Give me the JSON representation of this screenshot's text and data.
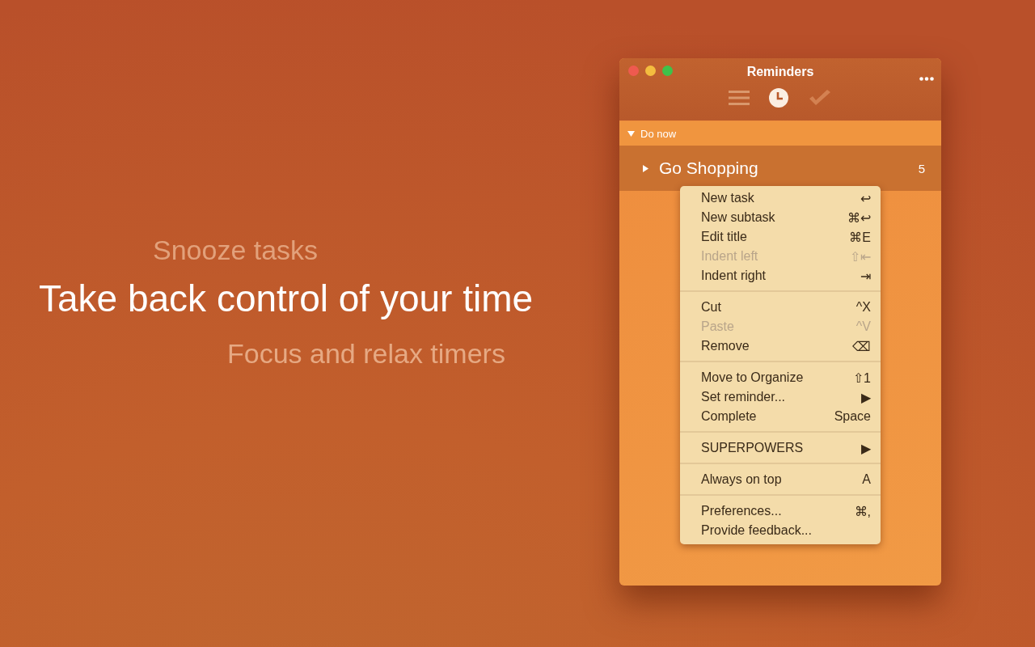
{
  "promo": {
    "subtitle": "Snooze tasks",
    "headline": "Take back control of your time",
    "tagline": "Focus and relax timers"
  },
  "window": {
    "title": "Reminders",
    "toolbar": [
      {
        "kind": "list",
        "selected": false
      },
      {
        "kind": "clock",
        "selected": true
      },
      {
        "kind": "done",
        "selected": false
      }
    ],
    "sections": [
      {
        "label": "Do now",
        "expanded": true,
        "tasks": [
          {
            "title": "Go Shopping",
            "count": "5",
            "expanded": false
          }
        ]
      }
    ]
  },
  "context_menu": {
    "groups": [
      [
        {
          "label": "New task",
          "shortcut": "↩",
          "disabled": false
        },
        {
          "label": "New subtask",
          "shortcut": "⌘↩",
          "disabled": false
        },
        {
          "label": "Edit title",
          "shortcut": "⌘E",
          "disabled": false
        },
        {
          "label": "Indent left",
          "shortcut": "⇧⇤",
          "disabled": true
        },
        {
          "label": "Indent right",
          "shortcut": "⇥",
          "disabled": false
        }
      ],
      [
        {
          "label": "Cut",
          "shortcut": "^X",
          "disabled": false
        },
        {
          "label": "Paste",
          "shortcut": "^V",
          "disabled": true
        },
        {
          "label": "Remove",
          "shortcut": "⌫",
          "disabled": false
        }
      ],
      [
        {
          "label": "Move to Organize",
          "shortcut": "⇧1",
          "disabled": false
        },
        {
          "label": "Set reminder...",
          "shortcut": "▶",
          "disabled": false
        },
        {
          "label": "Complete",
          "shortcut": "Space",
          "disabled": false
        }
      ],
      [
        {
          "label": "SUPERPOWERS",
          "shortcut": "▶",
          "disabled": false
        }
      ],
      [
        {
          "label": "Always on top",
          "shortcut": "A",
          "disabled": false
        }
      ],
      [
        {
          "label": "Preferences...",
          "shortcut": "⌘,",
          "disabled": false
        },
        {
          "label": "Provide feedback...",
          "disabled": false
        }
      ]
    ]
  }
}
